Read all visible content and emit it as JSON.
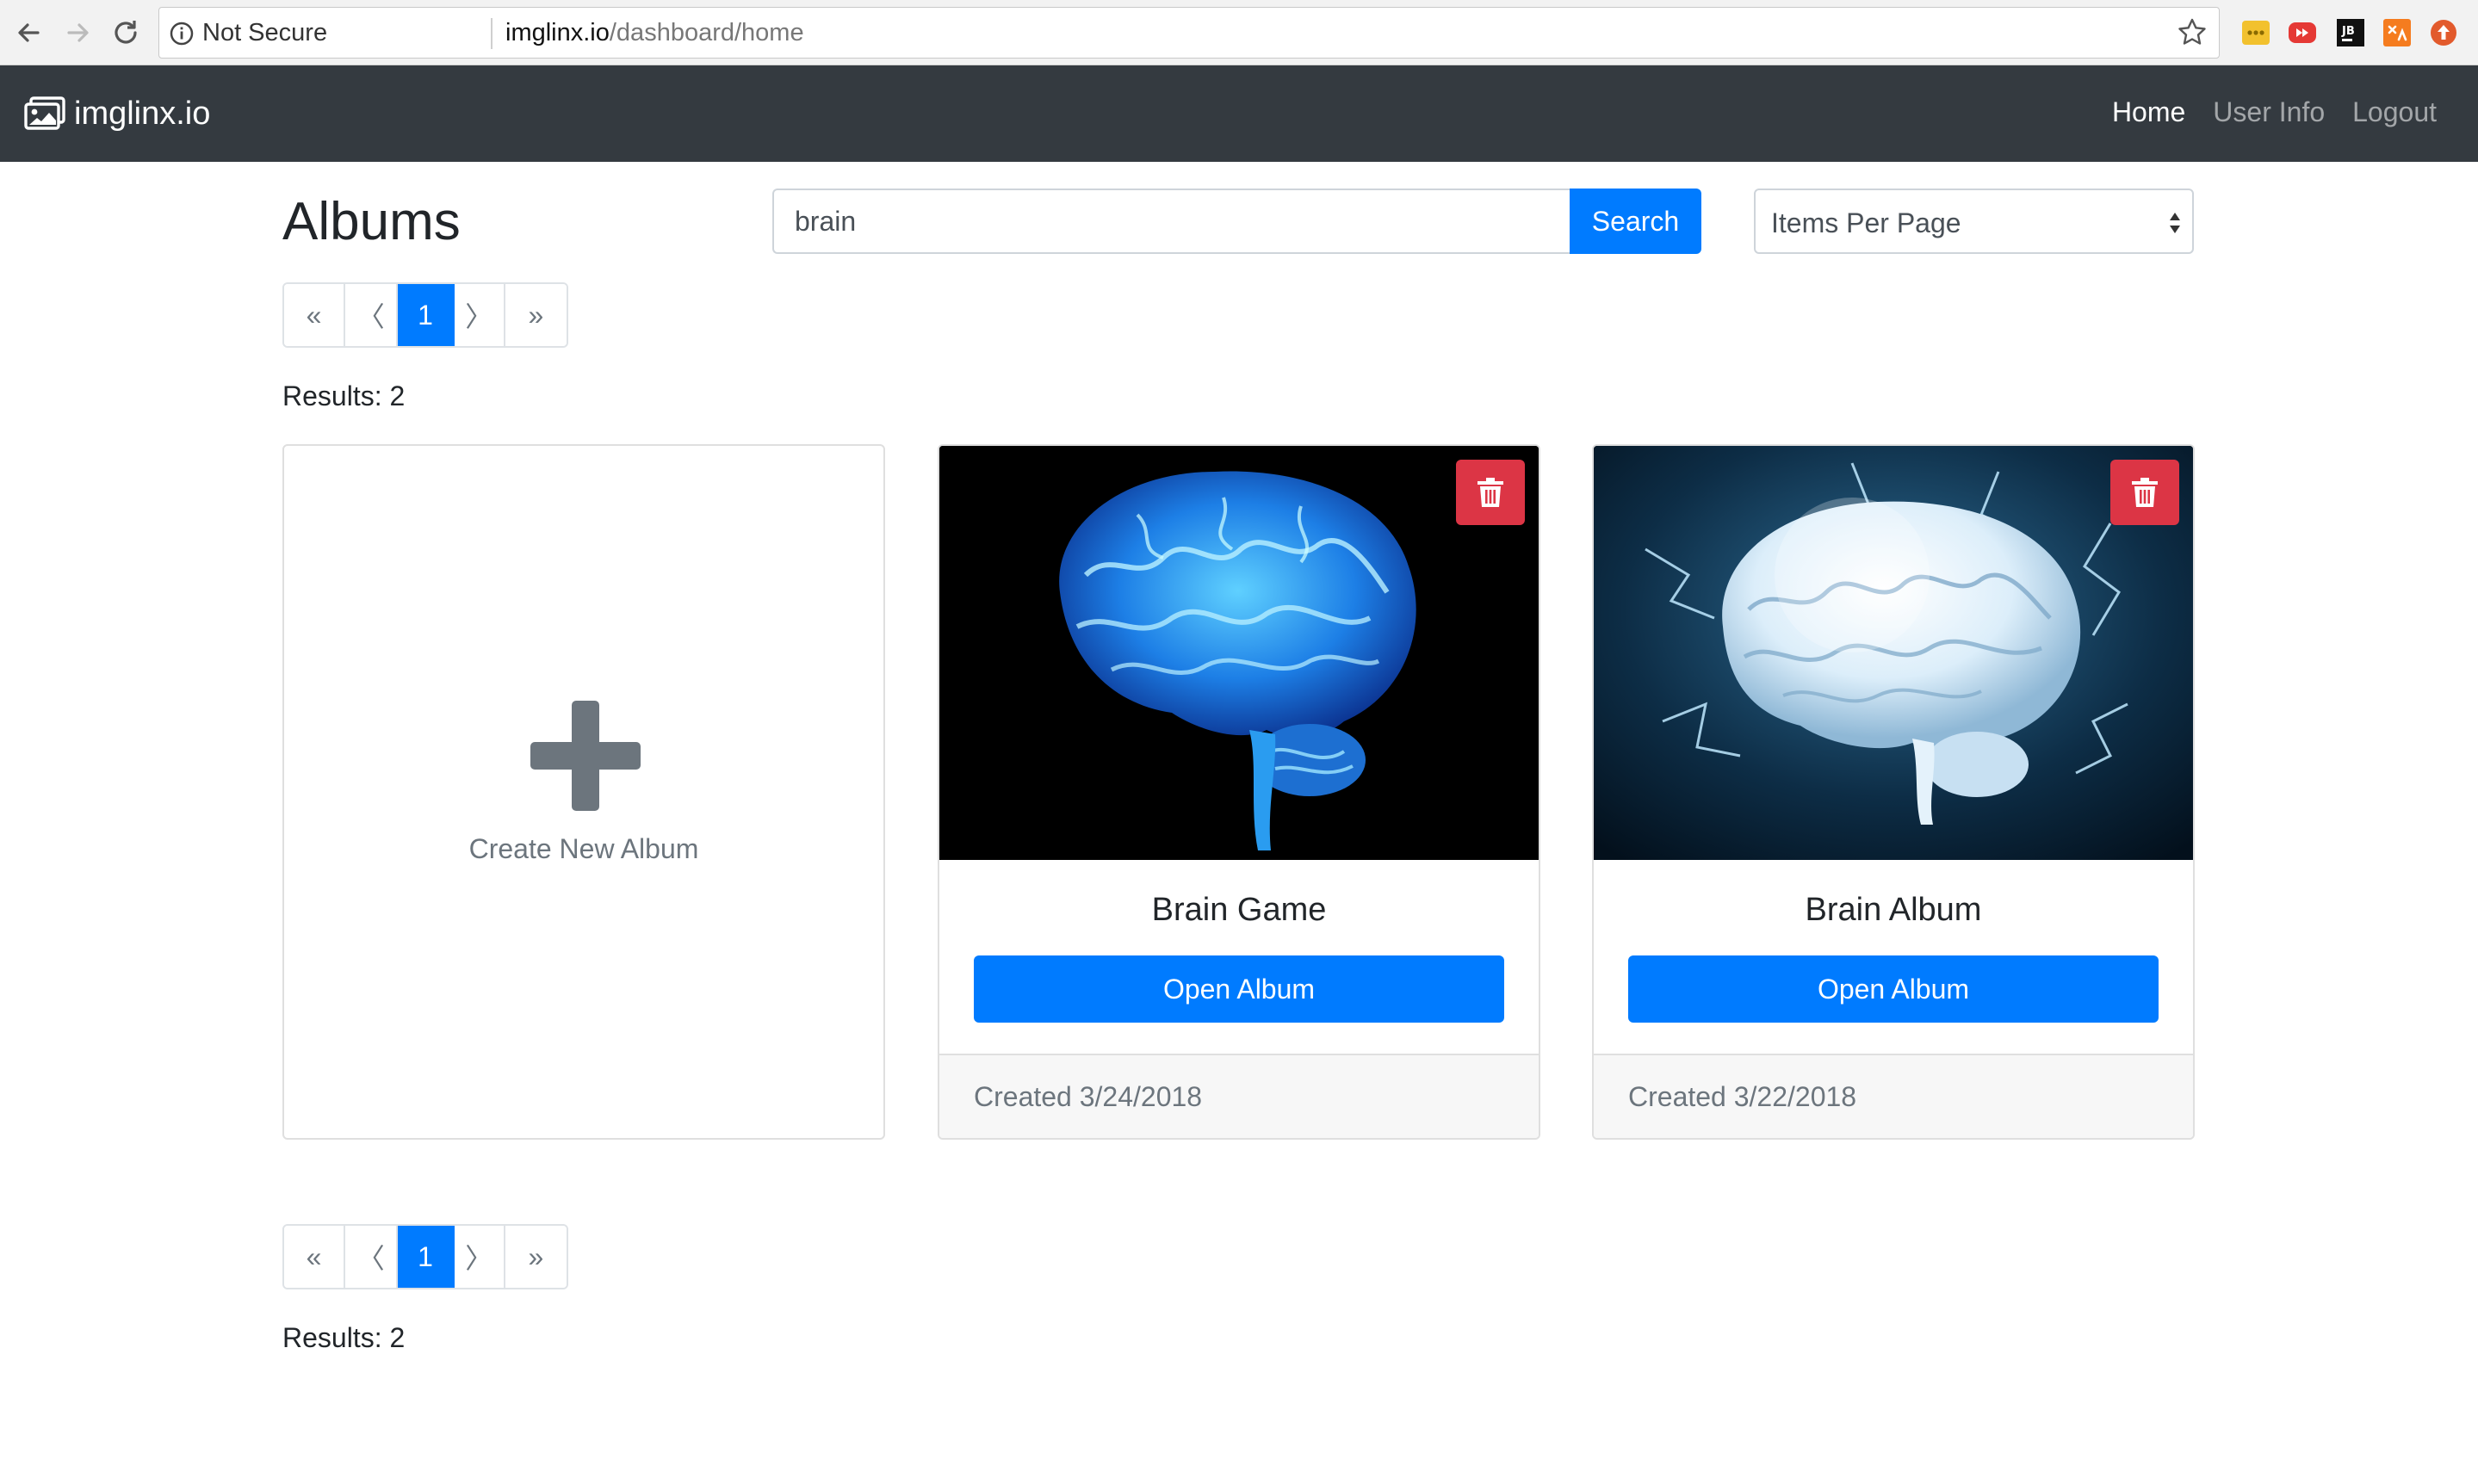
{
  "browser": {
    "security_label": "Not Secure",
    "url_host": "imglinx.io",
    "url_path": "/dashboard/home",
    "extensions": [
      "notes-extension-icon",
      "video-extension-icon",
      "jb-extension-icon",
      "translate-extension-icon",
      "upload-extension-icon"
    ]
  },
  "navbar": {
    "brand": "imglinx.io",
    "links": [
      {
        "label": "Home",
        "active": true
      },
      {
        "label": "User Info",
        "active": false
      },
      {
        "label": "Logout",
        "active": false
      }
    ]
  },
  "header": {
    "title": "Albums",
    "search_value": "brain",
    "search_button": "Search",
    "per_page_label": "Items Per Page"
  },
  "pagination": {
    "first": "«",
    "prev": "〈",
    "current": "1",
    "next": "〉",
    "last": "»"
  },
  "results_text": "Results: 2",
  "create_card": {
    "label": "Create New Album"
  },
  "albums": [
    {
      "title": "Brain Game",
      "button": "Open Album",
      "created": "Created 3/24/2018"
    },
    {
      "title": "Brain Album",
      "button": "Open Album",
      "created": "Created 3/22/2018"
    }
  ],
  "colors": {
    "primary": "#007bff",
    "danger": "#dc3545",
    "navbar": "#343a40"
  }
}
